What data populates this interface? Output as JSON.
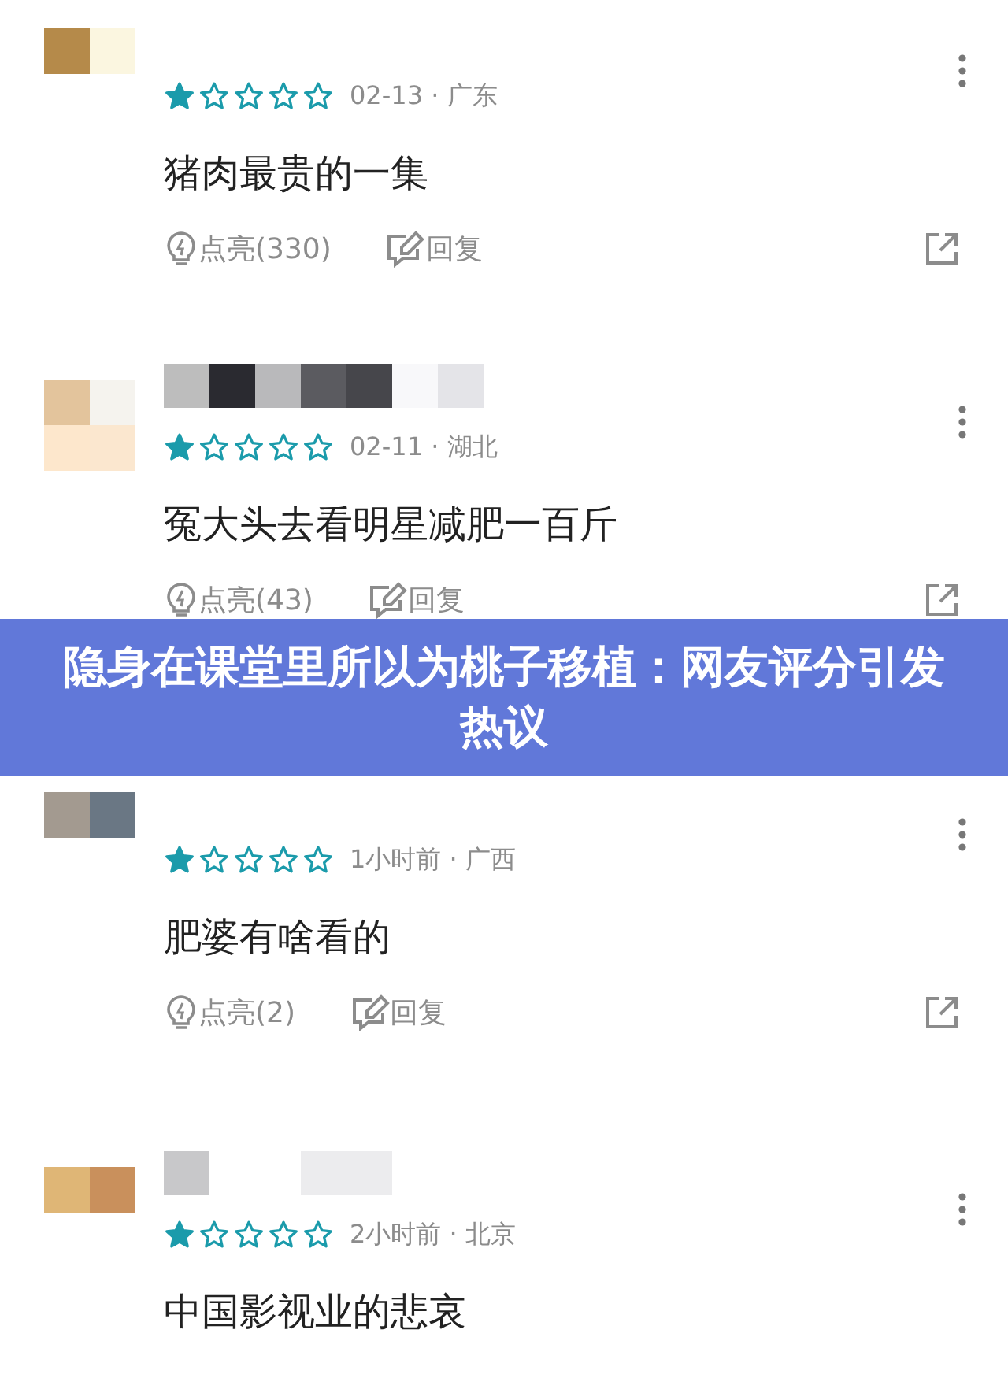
{
  "comments": [
    {
      "stars": 1,
      "meta": "02-13 · 广东",
      "text": "猪肉最贵的一集",
      "likes": "点亮(330)",
      "reply": "回复"
    },
    {
      "stars": 1,
      "meta": "02-11 · 湖北",
      "text": "冤大头去看明星减肥一百斤",
      "likes": "点亮(43)",
      "reply": "回复"
    },
    {
      "stars": 1,
      "meta": "1小时前 · 广西",
      "text": "肥婆有啥看的",
      "likes": "点亮(2)",
      "reply": "回复"
    },
    {
      "stars": 1,
      "meta": "2小时前 · 北京",
      "text": "中国影视业的悲哀"
    }
  ],
  "banner": {
    "title": "隐身在课堂里所以为桃子移植：网友评分引发热议"
  }
}
